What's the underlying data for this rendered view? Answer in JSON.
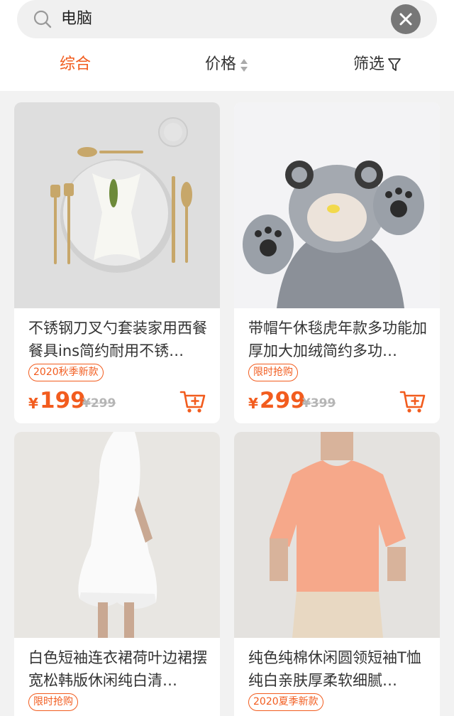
{
  "search": {
    "query": "电脑"
  },
  "tabs": {
    "comprehensive": "综合",
    "price": "价格",
    "filter": "筛选"
  },
  "colors": {
    "accent": "#f25c1e",
    "background": "#f2f2f2"
  },
  "products": [
    {
      "title": "不锈钢刀叉勺套装家用西餐餐具ins简约耐用不锈…",
      "tag": "2020秋季新款",
      "currency": "¥",
      "price": "199",
      "original_price": "¥299"
    },
    {
      "title": "带帽午休毯虎年款多功能加厚加大加绒简约多功…",
      "tag": "限时抢购",
      "currency": "¥",
      "price": "299",
      "original_price": "¥399"
    },
    {
      "title": "白色短袖连衣裙荷叶边裙摆宽松韩版休闲纯白清…",
      "tag": "限时抢购"
    },
    {
      "title": "纯色纯棉休闲圆领短袖T恤纯白亲肤厚柔软细腻…",
      "tag": "2020夏季新款"
    }
  ]
}
